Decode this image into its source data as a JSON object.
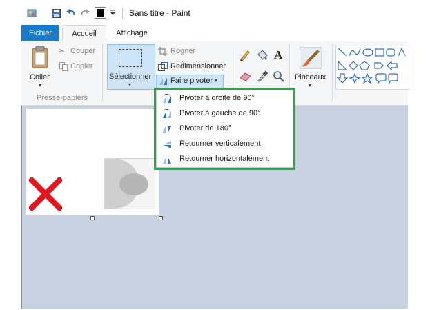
{
  "titlebar": {
    "title": "Sans titre - Paint"
  },
  "tabs": {
    "file": "Fichier",
    "home": "Accueil",
    "view": "Affichage"
  },
  "clipboard": {
    "paste": "Coller",
    "cut": "Couper",
    "copy": "Copier",
    "group": "Presse-papiers"
  },
  "image": {
    "select": "Sélectionner",
    "crop": "Rogner",
    "resize": "Redimensionner",
    "rotate": "Faire pivoter"
  },
  "brushes": {
    "label": "Pinceaux"
  },
  "rotate_menu": {
    "items": [
      {
        "label": "Pivoter à droite de 90°",
        "icon": "rotate-right-90-icon"
      },
      {
        "label": "Pivoter à gauche de 90°",
        "icon": "rotate-left-90-icon"
      },
      {
        "label": "Pivoter de 180°",
        "icon": "rotate-180-icon"
      },
      {
        "label": "Retourner verticalement",
        "icon": "flip-vertical-icon"
      },
      {
        "label": "Retourner horizontalement",
        "icon": "flip-horizontal-icon"
      }
    ]
  },
  "colors": {
    "accent": "#1979ca",
    "highlight": "#2aa845",
    "canvas_bg": "#c8d1e0",
    "x_mark": "#e8131b"
  }
}
